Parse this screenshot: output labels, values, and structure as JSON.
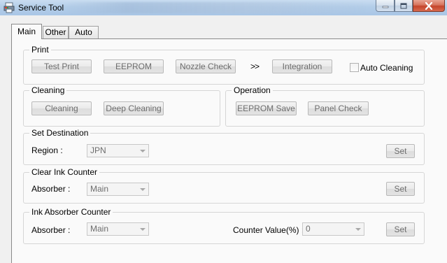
{
  "window": {
    "title": "Service Tool"
  },
  "tabs": [
    {
      "label": "Main"
    },
    {
      "label": "Other"
    },
    {
      "label": "Auto"
    }
  ],
  "print": {
    "title": "Print",
    "test_print": "Test Print",
    "eeprom": "EEPROM",
    "nozzle_check": "Nozzle Check",
    "arrows": ">>",
    "integration": "Integration",
    "auto_cleaning": "Auto Cleaning",
    "auto_cleaning_checked": false
  },
  "cleaning": {
    "title": "Cleaning",
    "cleaning": "Cleaning",
    "deep_cleaning": "Deep Cleaning"
  },
  "operation": {
    "title": "Operation",
    "eeprom_save": "EEPROM Save",
    "panel_check": "Panel Check"
  },
  "set_destination": {
    "title": "Set Destination",
    "region_label": "Region :",
    "region_value": "JPN",
    "set": "Set"
  },
  "clear_ink_counter": {
    "title": "Clear Ink Counter",
    "absorber_label": "Absorber :",
    "absorber_value": "Main",
    "set": "Set"
  },
  "ink_absorber_counter": {
    "title": "Ink Absorber Counter",
    "absorber_label": "Absorber :",
    "absorber_value": "Main",
    "counter_label": "Counter Value(%) :",
    "counter_value": "0",
    "set": "Set"
  }
}
